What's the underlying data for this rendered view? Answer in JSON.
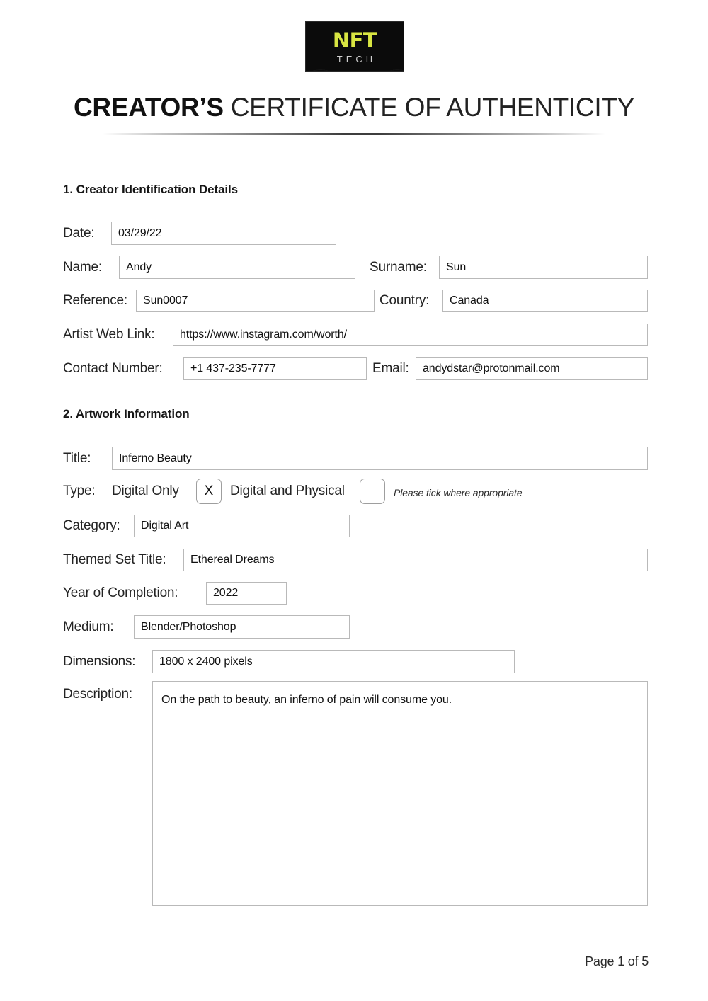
{
  "logo": {
    "line1": "NFT",
    "line2": "TECH",
    "line1_color": "#d8e542",
    "line2_color": "#cfcfcf",
    "background_color": "#0b0b0b"
  },
  "header": {
    "title_bold": "CREATOR’S",
    "title_rest": " CERTIFICATE OF AUTHENTICITY"
  },
  "section1": {
    "heading": "1. Creator Identification Details",
    "fields": {
      "date_label": "Date:",
      "date_value": "03/29/22",
      "name_label": "Name:",
      "name_value": "Andy",
      "surname_label": "Surname:",
      "surname_value": "Sun",
      "reference_label": "Reference:",
      "reference_value": "Sun0007",
      "country_label": "Country:",
      "country_value": "Canada",
      "weblink_label": "Artist Web Link:",
      "weblink_value": "https://www.instagram.com/worth/",
      "contact_label": "Contact Number:",
      "contact_value": "+1 437-235-7777",
      "email_label": "Email:",
      "email_value": "andydstar@protonmail.com"
    }
  },
  "section2": {
    "heading": "2. Artwork Information",
    "fields": {
      "title_label": "Title:",
      "title_value": "Inferno Beauty",
      "type_label": "Type:",
      "type_option_1": "Digital Only",
      "type_option_1_mark": "X",
      "type_option_2": "Digital and Physical",
      "type_option_2_mark": "",
      "type_note": "Please tick where appropriate",
      "category_label": "Category:",
      "category_value": "Digital Art",
      "themed_label": "Themed Set Title:",
      "themed_value": "Ethereal Dreams",
      "year_label": "Year of Completion:",
      "year_value": "2022",
      "medium_label": "Medium:",
      "medium_value": "Blender/Photoshop",
      "dimensions_label": "Dimensions:",
      "dimensions_value": "1800 x 2400 pixels",
      "description_label": "Description:",
      "description_value": "On the path to beauty, an inferno of pain will consume you."
    }
  },
  "footer": {
    "page_text": "Page 1 of 5"
  }
}
